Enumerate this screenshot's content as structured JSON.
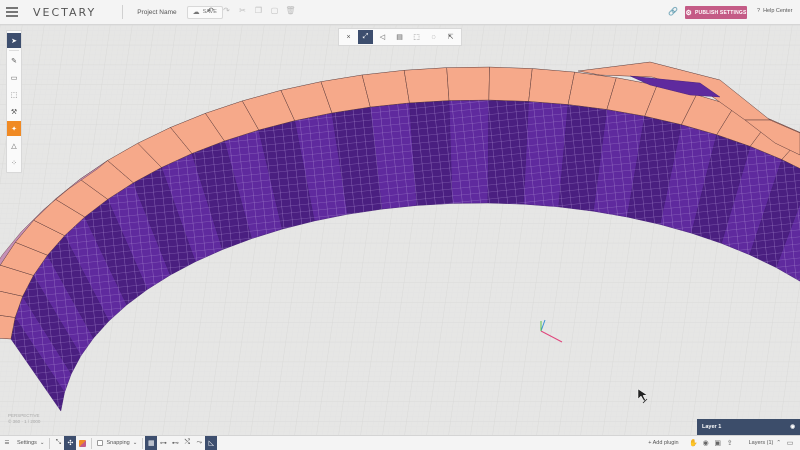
{
  "app": {
    "logo": "VECTARY",
    "project_name": "Project Name",
    "save_label": "SAVE",
    "publish_label": "PUBLISH SETTINGS",
    "help_label": "Help Center"
  },
  "viewport": {
    "perspective_label": "PERSPECTIVE",
    "perspective_sub": "© 360 · 1 / 2000",
    "colors": {
      "ring_top": "#f6a98a",
      "ring_side": "#5f2a9e",
      "ring_side_dark": "#4a1f80",
      "grid": "#d6d6d5",
      "background": "#e6e6e5"
    }
  },
  "left_toolbar": {
    "items": [
      "select-icon",
      "pen-icon",
      "box-icon",
      "cube-icon",
      "hammer-icon",
      "paint-icon",
      "triangle-icon",
      "scatter-icon"
    ]
  },
  "center_toolbar": {
    "items": [
      "close-icon",
      "edit-icon",
      "vertex-icon",
      "face-icon",
      "rect-select-icon",
      "lasso-icon",
      "paint-select-icon"
    ]
  },
  "layer_panel": {
    "title": "Layer 1",
    "eye": "◉"
  },
  "bottombar": {
    "settings_label": "Settings",
    "snapping_label": "Snapping",
    "add_plugin_label": "+ Add plugin",
    "layers_label": "Layers (1)",
    "layers_chevron": "⌃"
  }
}
